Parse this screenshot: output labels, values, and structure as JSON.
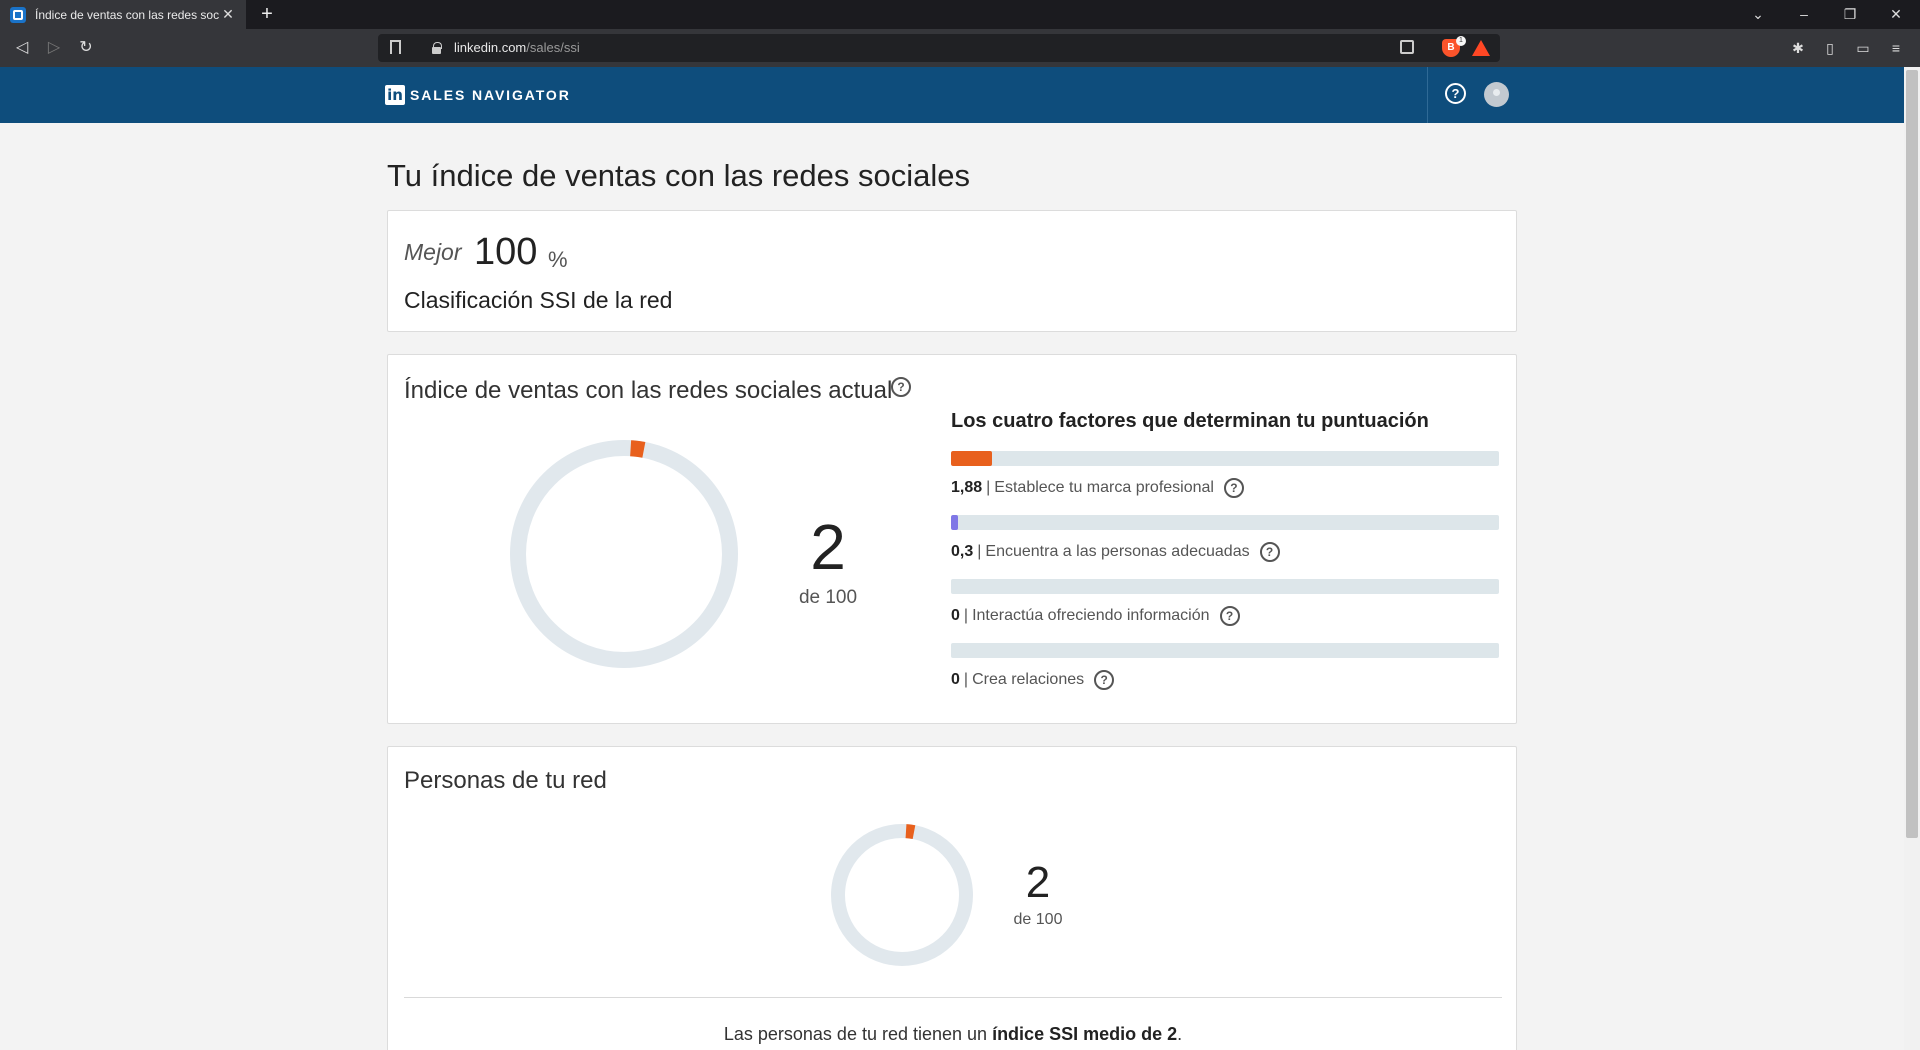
{
  "browser": {
    "tab_title": "Índice de ventas con las redes soc",
    "url_host": "linkedin.com",
    "url_path": "/sales/ssi",
    "brave_badge": "1"
  },
  "app": {
    "logo": "in",
    "brand": "SALES NAVIGATOR",
    "help_icon": "?"
  },
  "page": {
    "title": "Tu índice de ventas con las redes sociales"
  },
  "rank_card": {
    "best_label": "Mejor",
    "best_value": "100",
    "best_unit": "%",
    "rank_label": "Clasificación SSI de la red"
  },
  "ssi_card": {
    "title": "Índice de ventas con las redes sociales actual",
    "help_icon": "?",
    "score": "2",
    "score_of": "de 100",
    "score_value": 2,
    "factors_title": "Los cuatro factores que determinan tu puntuación",
    "factors": [
      {
        "value": "1,88",
        "label": "Establece tu marca profesional",
        "fill": 0.075,
        "color": "#e8601d"
      },
      {
        "value": "0,3",
        "label": "Encuentra a las personas adecuadas",
        "fill": 0.012,
        "color": "#7f77e6"
      },
      {
        "value": "0",
        "label": "Interactúa ofreciendo información",
        "fill": 0,
        "color": "#e8601d"
      },
      {
        "value": "0",
        "label": "Crea relaciones",
        "fill": 0,
        "color": "#e8601d"
      }
    ],
    "accent": "#e8601d",
    "ring_track": "#e1e8ed"
  },
  "network_card": {
    "title": "Personas de tu red",
    "score": "2",
    "score_of": "de 100",
    "score_value": 2,
    "avg_prefix": "Las personas de tu red tienen un ",
    "avg_bold": "índice SSI medio de 2",
    "avg_suffix": "."
  }
}
